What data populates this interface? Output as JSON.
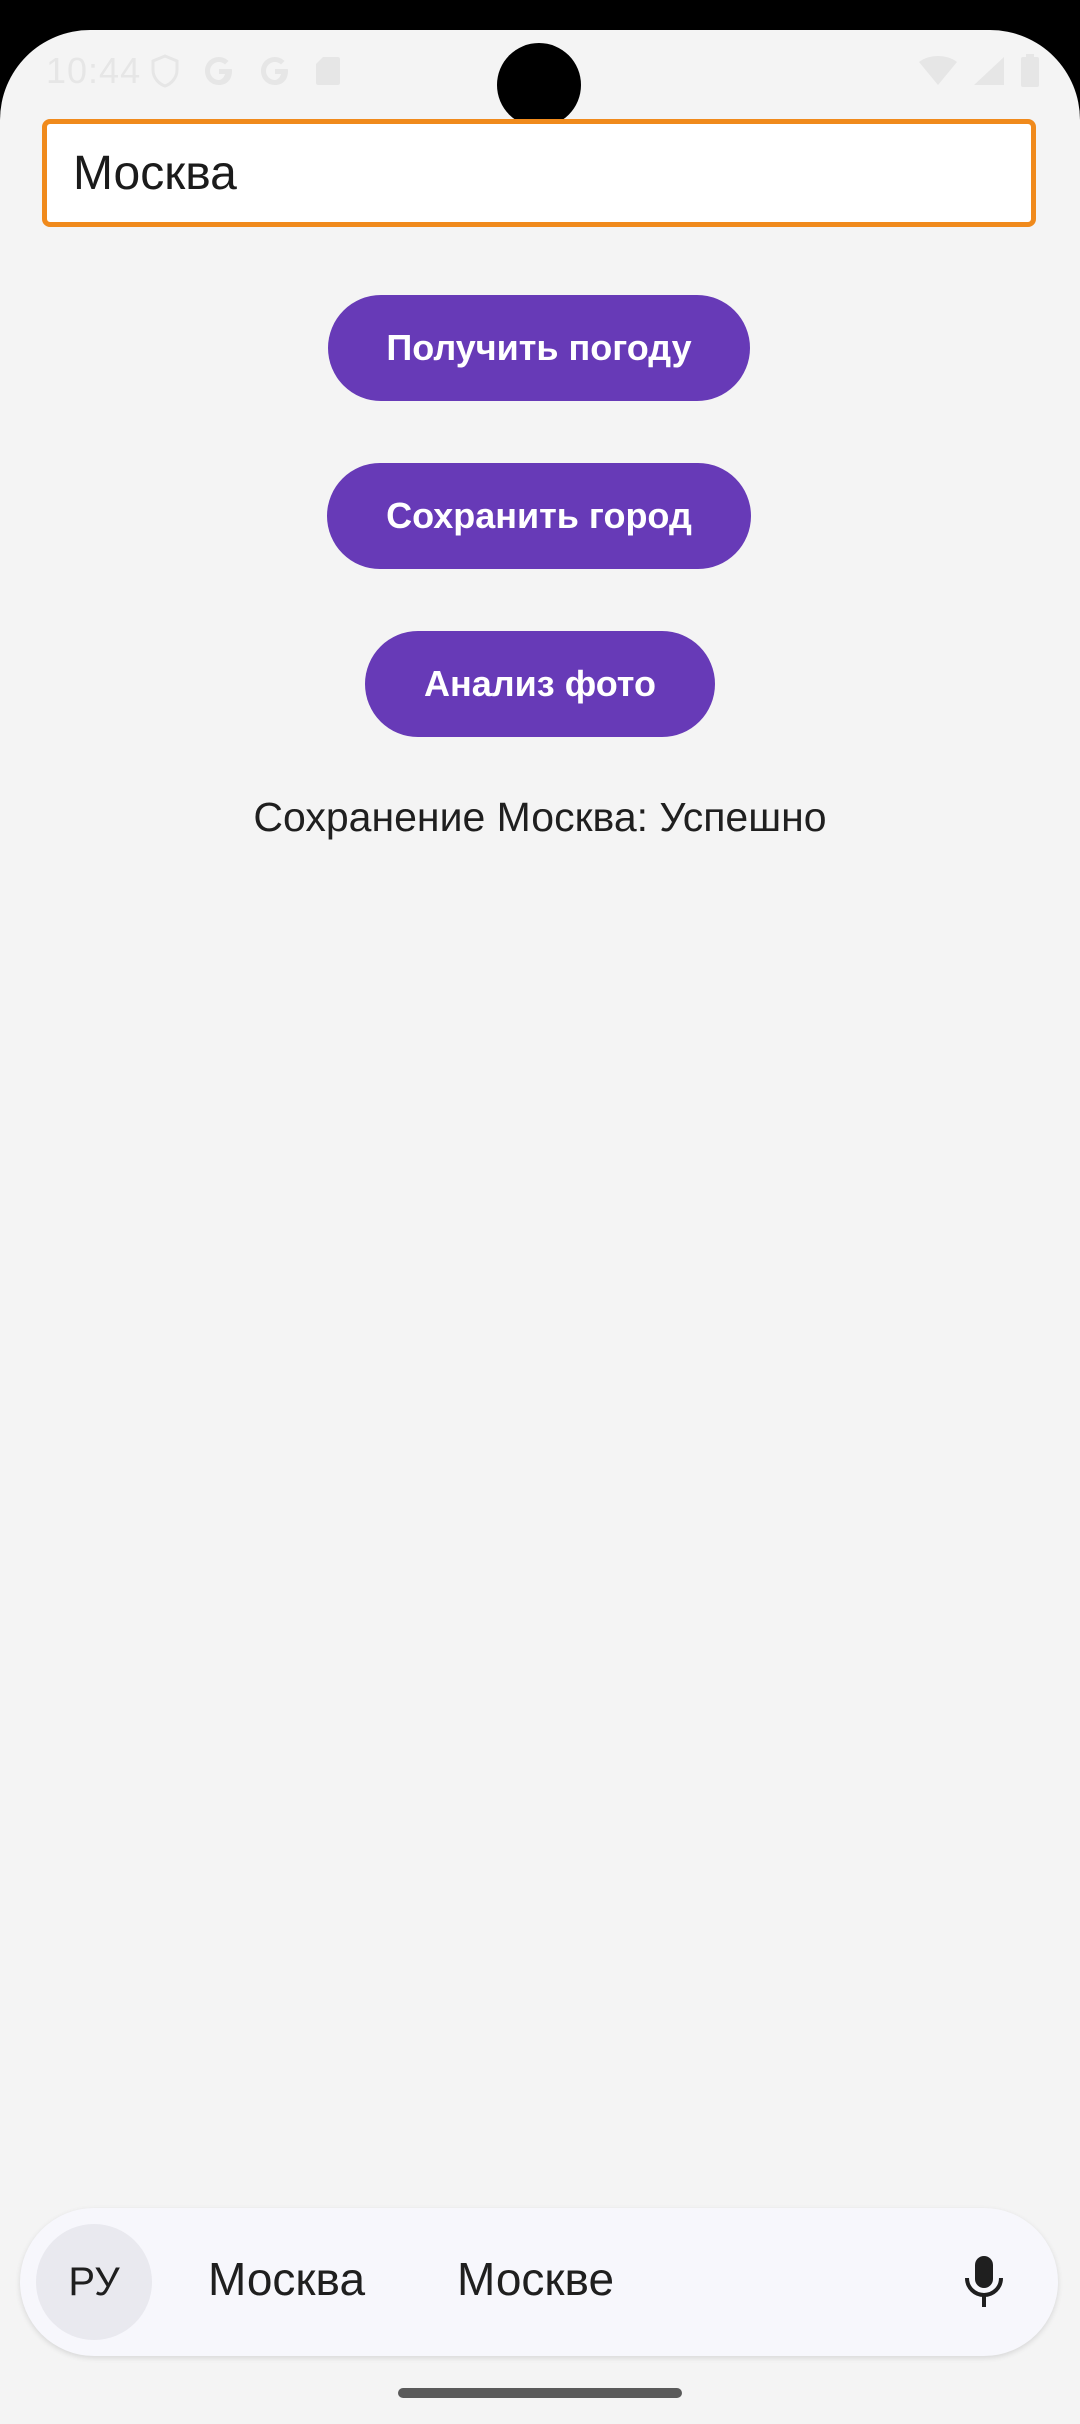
{
  "status_bar": {
    "time": "10:44"
  },
  "city_input": {
    "value": "Москва"
  },
  "buttons": {
    "get_weather": "Получить погоду",
    "save_city": "Сохранить город",
    "photo_analysis": "Анализ фото"
  },
  "result_text": "Сохранение Москва: Успешно",
  "keyboard": {
    "language": "РУ",
    "suggestions": [
      "Москва",
      "Москве"
    ],
    "mic_icon": "microphone-icon"
  },
  "colors": {
    "accent": "#673ab7",
    "input_border": "#f08a1c",
    "background": "#f4f4f4"
  }
}
